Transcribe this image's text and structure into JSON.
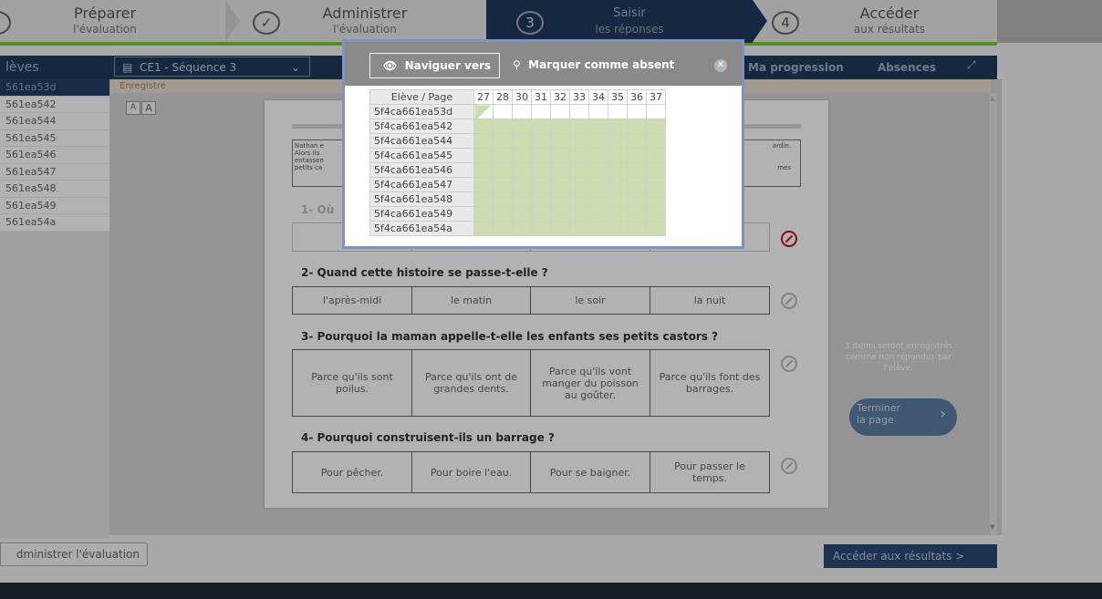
{
  "stepper": {
    "steps": [
      {
        "line1": "Préparer",
        "line2": "l'évaluation"
      },
      {
        "line1": "Administrer",
        "line2": "l'évaluation"
      },
      {
        "number": "3",
        "line1": "Saisir",
        "line2": "les réponses"
      },
      {
        "number": "4",
        "line1": "Accéder",
        "line2": "aux résultats"
      }
    ],
    "check_icon": "check-icon"
  },
  "toolbar": {
    "students_title": "lèves",
    "sequence": "CE1 - Séquence 3",
    "tab_progress": "Ma progression",
    "tab_absences": "Absences"
  },
  "students": [
    "561ea53d",
    "561ea542",
    "561ea544",
    "561ea545",
    "561ea546",
    "561ea547",
    "561ea548",
    "561ea549",
    "561ea54a"
  ],
  "saved_label": "Enregistré",
  "font_buttons": [
    "A",
    "A"
  ],
  "passage": {
    "left": [
      "Nathan e",
      "Alors ils",
      "entassen",
      "petits ca"
    ],
    "right": [
      "ardin.",
      "",
      "mes",
      ""
    ]
  },
  "questions": [
    {
      "title": "1- Où",
      "answers": [
        "",
        "",
        "",
        ""
      ]
    },
    {
      "title": "2- Quand cette histoire se passe-t-elle ?",
      "answers": [
        "l'après-midi",
        "le matin",
        "le soir",
        "la nuit"
      ]
    },
    {
      "title": "3- Pourquoi la maman appelle-t-elle les enfants ses petits castors ?",
      "answers": [
        "Parce qu'ils sont poilus.",
        "Parce qu'ils ont de grandes dents.",
        "Parce qu'ils vont manger du poisson au goûter.",
        "Parce qu'ils font des barrages."
      ]
    },
    {
      "title": "4- Pourquoi construisent-ils un barrage ?",
      "answers": [
        "Pour pêcher.",
        "Pour boire l'eau.",
        "Pour se baigner.",
        "Pour passer le temps."
      ]
    }
  ],
  "side_info": "3 items seront enregistrés comme non répondus par l'élève.",
  "finish_button": {
    "line1": "Terminer",
    "line2": "la page"
  },
  "admin_button": "dministrer l'évaluation",
  "results_button": "Accéder aux résultats  >",
  "modal": {
    "navigate_label": "Naviguer vers",
    "absent_label": "Marquer comme absent",
    "column_header": "Elève / Page",
    "pages": [
      "27",
      "28",
      "30",
      "31",
      "32",
      "33",
      "34",
      "35",
      "36",
      "37"
    ],
    "rows": [
      "5f4ca661ea53d",
      "5f4ca661ea542",
      "5f4ca661ea544",
      "5f4ca661ea545",
      "5f4ca661ea546",
      "5f4ca661ea547",
      "5f4ca661ea548",
      "5f4ca661ea549",
      "5f4ca661ea54a"
    ]
  },
  "colors": {
    "nav_dark": "#1e3c5c",
    "progress_green": "#7ccd2f",
    "cell_green": "#ccdcb0",
    "modal_frame": "#7e93c4",
    "no_answer_red": "#c0101a"
  }
}
